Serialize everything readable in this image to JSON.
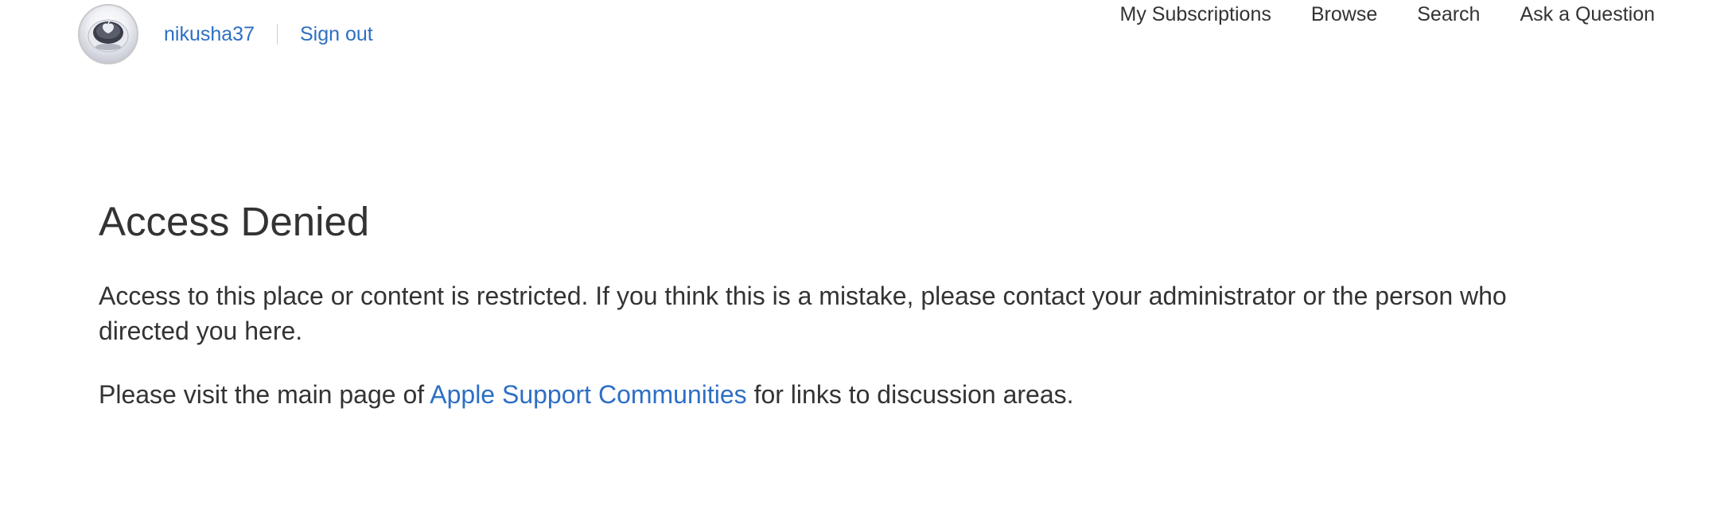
{
  "header": {
    "user": {
      "avatar_icon": "apple-computer-avatar-icon",
      "username": "nikusha37",
      "sign_out_label": "Sign out"
    },
    "nav": {
      "my_subscriptions": "My Subscriptions",
      "browse": "Browse",
      "search": "Search",
      "ask_question": "Ask a Question"
    }
  },
  "main": {
    "title": "Access Denied",
    "message": "Access to this place or content is restricted. If you think this is a mistake, please contact your administrator or the person who directed you here.",
    "visit_prefix": "Please visit the main page of ",
    "visit_link": "Apple Support Communities",
    "visit_suffix": " for links to discussion areas."
  },
  "colors": {
    "link": "#2d6fc4",
    "text": "#333333",
    "background": "#ffffff"
  }
}
